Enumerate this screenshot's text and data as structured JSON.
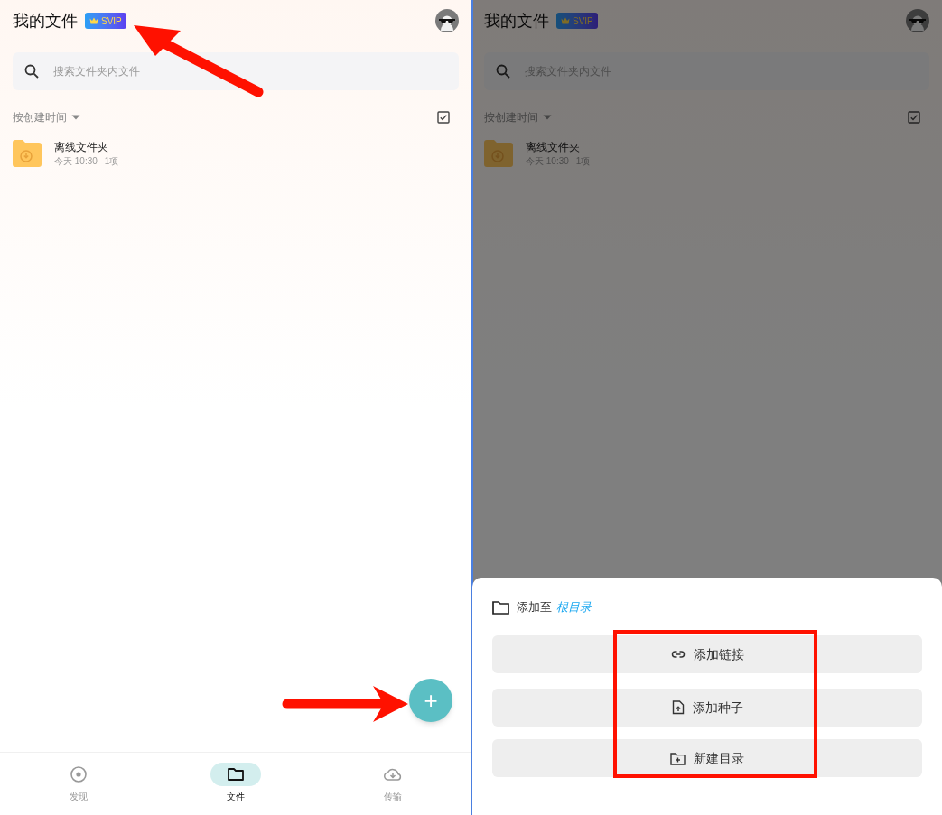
{
  "screens": [
    {
      "header": {
        "title": "我的文件",
        "badge": "SVIP"
      },
      "search": {
        "placeholder": "搜索文件夹内文件"
      },
      "sort": {
        "label": "按创建时间"
      },
      "items": [
        {
          "name": "离线文件夹",
          "date": "今天 10:30",
          "count": "1项"
        }
      ],
      "fab": {
        "label": "+"
      },
      "nav": [
        {
          "label": "发现",
          "kind": "discover",
          "selected": false
        },
        {
          "label": "文件",
          "kind": "files",
          "selected": true
        },
        {
          "label": "传输",
          "kind": "transfer",
          "selected": false
        }
      ]
    },
    {
      "header": {
        "title": "我的文件",
        "badge": "SVIP"
      },
      "search": {
        "placeholder": "搜索文件夹内文件"
      },
      "sort": {
        "label": "按创建时间"
      },
      "items": [
        {
          "name": "离线文件夹",
          "date": "今天 10:30",
          "count": "1项"
        }
      ],
      "sheet": {
        "prefix": "添加至",
        "target": "根目录",
        "actions": [
          {
            "label": "添加链接",
            "kind": "link"
          },
          {
            "label": "添加种子",
            "kind": "torrent"
          },
          {
            "label": "新建目录",
            "kind": "folder"
          }
        ]
      }
    }
  ]
}
